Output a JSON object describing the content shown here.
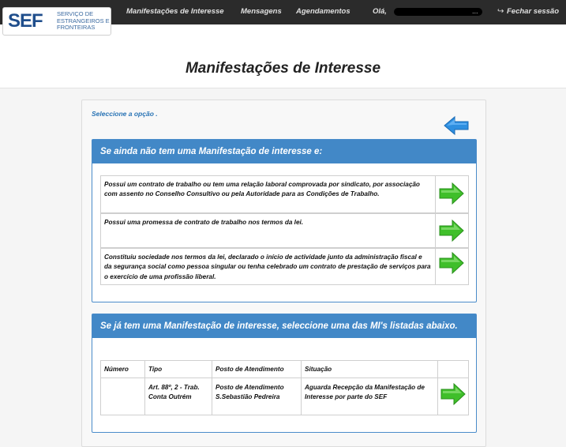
{
  "header": {
    "logo_text": "SEF",
    "logo_sub": "SERVIÇO DE ESTRANGEIROS E FRONTEIRAS",
    "nav": {
      "manifestacoes": "Manifestações de Interesse",
      "mensagens": "Mensagens",
      "agendamentos": "Agendamentos",
      "greeting": "Olá,",
      "greeting_suffix": "...",
      "logout": "Fechar sessão"
    }
  },
  "page": {
    "title": "Manifestações de Interesse",
    "select_label": "Seleccione a opção ."
  },
  "section1": {
    "heading": "Se ainda não tem uma Manifestação de interesse e:",
    "options": [
      "Possui um contrato de trabalho ou tem uma relação laboral comprovada por sindicato, por associação com assento no Conselho Consultivo ou pela Autoridade para as Condições de Trabalho.",
      "Possui uma promessa de contrato de trabalho nos termos da lei.",
      "Constituiu sociedade nos termos da lei, declarado o início de actividade junto da administração fiscal e da segurança social como pessoa singular ou tenha celebrado um contrato de prestação de serviços para o exercício de uma profissão liberal."
    ]
  },
  "section2": {
    "heading": "Se já tem uma Manifestação de interesse, seleccione uma das MI's listadas abaixo.",
    "table": {
      "headers": [
        "Número",
        "Tipo",
        "Posto de Atendimento",
        "Situação"
      ],
      "rows": [
        {
          "numero": "",
          "tipo": "Art. 88º, 2 - Trab. Conta Outrém",
          "posto": "Posto de Atendimento S.Sebastião Pedreira",
          "situacao": "Aguarda Recepção da Manifestação de Interesse por parte do SEF"
        }
      ]
    }
  },
  "colors": {
    "topbar": "#2b2b2b",
    "section_header": "#4288c7",
    "arrow_green": "#3fbf2a",
    "arrow_blue": "#2e8fe0"
  }
}
